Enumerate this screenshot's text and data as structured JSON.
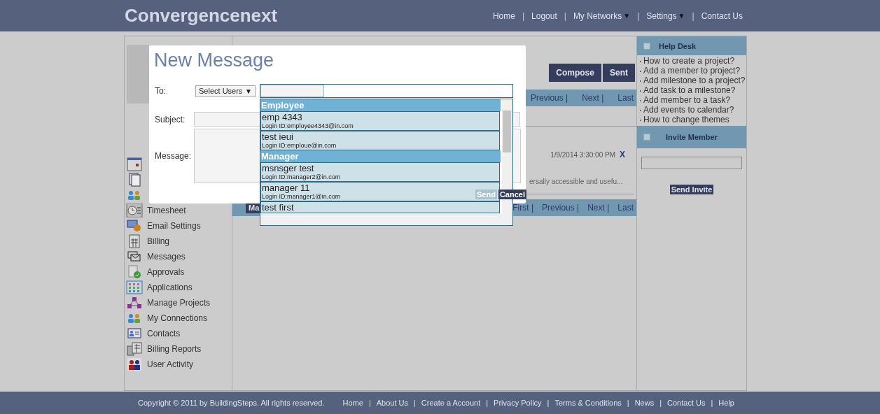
{
  "header": {
    "logo": "Convergencenext",
    "nav": [
      {
        "label": "Home",
        "caret": false
      },
      {
        "label": "Logout",
        "caret": false
      },
      {
        "label": "My Networks",
        "caret": true
      },
      {
        "label": "Settings",
        "caret": true
      },
      {
        "label": "Contact Us",
        "caret": false
      }
    ],
    "caret_glyph": "▼",
    "separator": "|"
  },
  "sidebar": {
    "items": [
      {
        "kind": "calendar"
      },
      {
        "kind": "documents"
      },
      {
        "kind": "people"
      },
      {
        "kind": "timesheet",
        "label": "Timesheet"
      },
      {
        "kind": "email",
        "label": "Email Settings"
      },
      {
        "kind": "billing",
        "label": "Billing"
      },
      {
        "kind": "envelopes",
        "label": "Messages"
      },
      {
        "kind": "approval",
        "label": "Approvals"
      },
      {
        "kind": "grid",
        "label": "Applications"
      },
      {
        "kind": "network",
        "label": "Manage Projects"
      },
      {
        "kind": "people",
        "label": "My Connections"
      },
      {
        "kind": "contact",
        "label": "Contacts"
      },
      {
        "kind": "calculator",
        "label": "Billing Reports"
      },
      {
        "kind": "users",
        "label": "User Activity"
      }
    ]
  },
  "inbox": {
    "buttons": [
      "Compose",
      "Sent"
    ],
    "top_pager": [
      "Previous |",
      "Next |",
      "Last"
    ],
    "message": {
      "date": "1/9/2014 3:30:00 PM",
      "delete": "X",
      "snippet": "ersally accessible and usefu..."
    },
    "bottom_button": "Ma",
    "bottom_pager": [
      "First |",
      "Previous |",
      "Next |",
      "Last"
    ]
  },
  "help_desk": {
    "title": "Help Desk",
    "links": [
      "How to create a project?",
      "Add a member to project?",
      "Add milestone to a project?",
      "Add task to a milestone?",
      "Add member to a task?",
      "Add events to calendar?",
      "How to change themes"
    ]
  },
  "invite": {
    "title": "Invite Member",
    "button": "Send Invite"
  },
  "modal": {
    "title": "New Message",
    "to_label": "To:",
    "select": "Select Users",
    "select_caret": "▼",
    "subject_label": "Subject:",
    "message_label": "Message:",
    "buttons": [
      "Send",
      "Cancel"
    ]
  },
  "user_list": [
    {
      "kind": "group",
      "label": "Employee"
    },
    {
      "kind": "user",
      "name": "emp 4343",
      "login": "Login ID:employee4343@in.com"
    },
    {
      "kind": "user",
      "name": "test ieui",
      "login": "Login ID:emploue@in.com"
    },
    {
      "kind": "group",
      "label": "Manager"
    },
    {
      "kind": "user",
      "name": "msnsger test",
      "login": "Login ID:manager2@in.com"
    },
    {
      "kind": "user",
      "name": "manager 11",
      "login": "Login ID:manager1@in.com"
    },
    {
      "kind": "user",
      "name": "test first"
    }
  ],
  "footer": {
    "copyright": "Copyright © 2011 by BuildingSteps. All rights reserved.",
    "links": [
      "Home",
      "About Us",
      "Create a Account",
      "Privacy Policy",
      "Terms & Conditions",
      "News",
      "Contact Us",
      "Help"
    ],
    "separator": "|"
  }
}
